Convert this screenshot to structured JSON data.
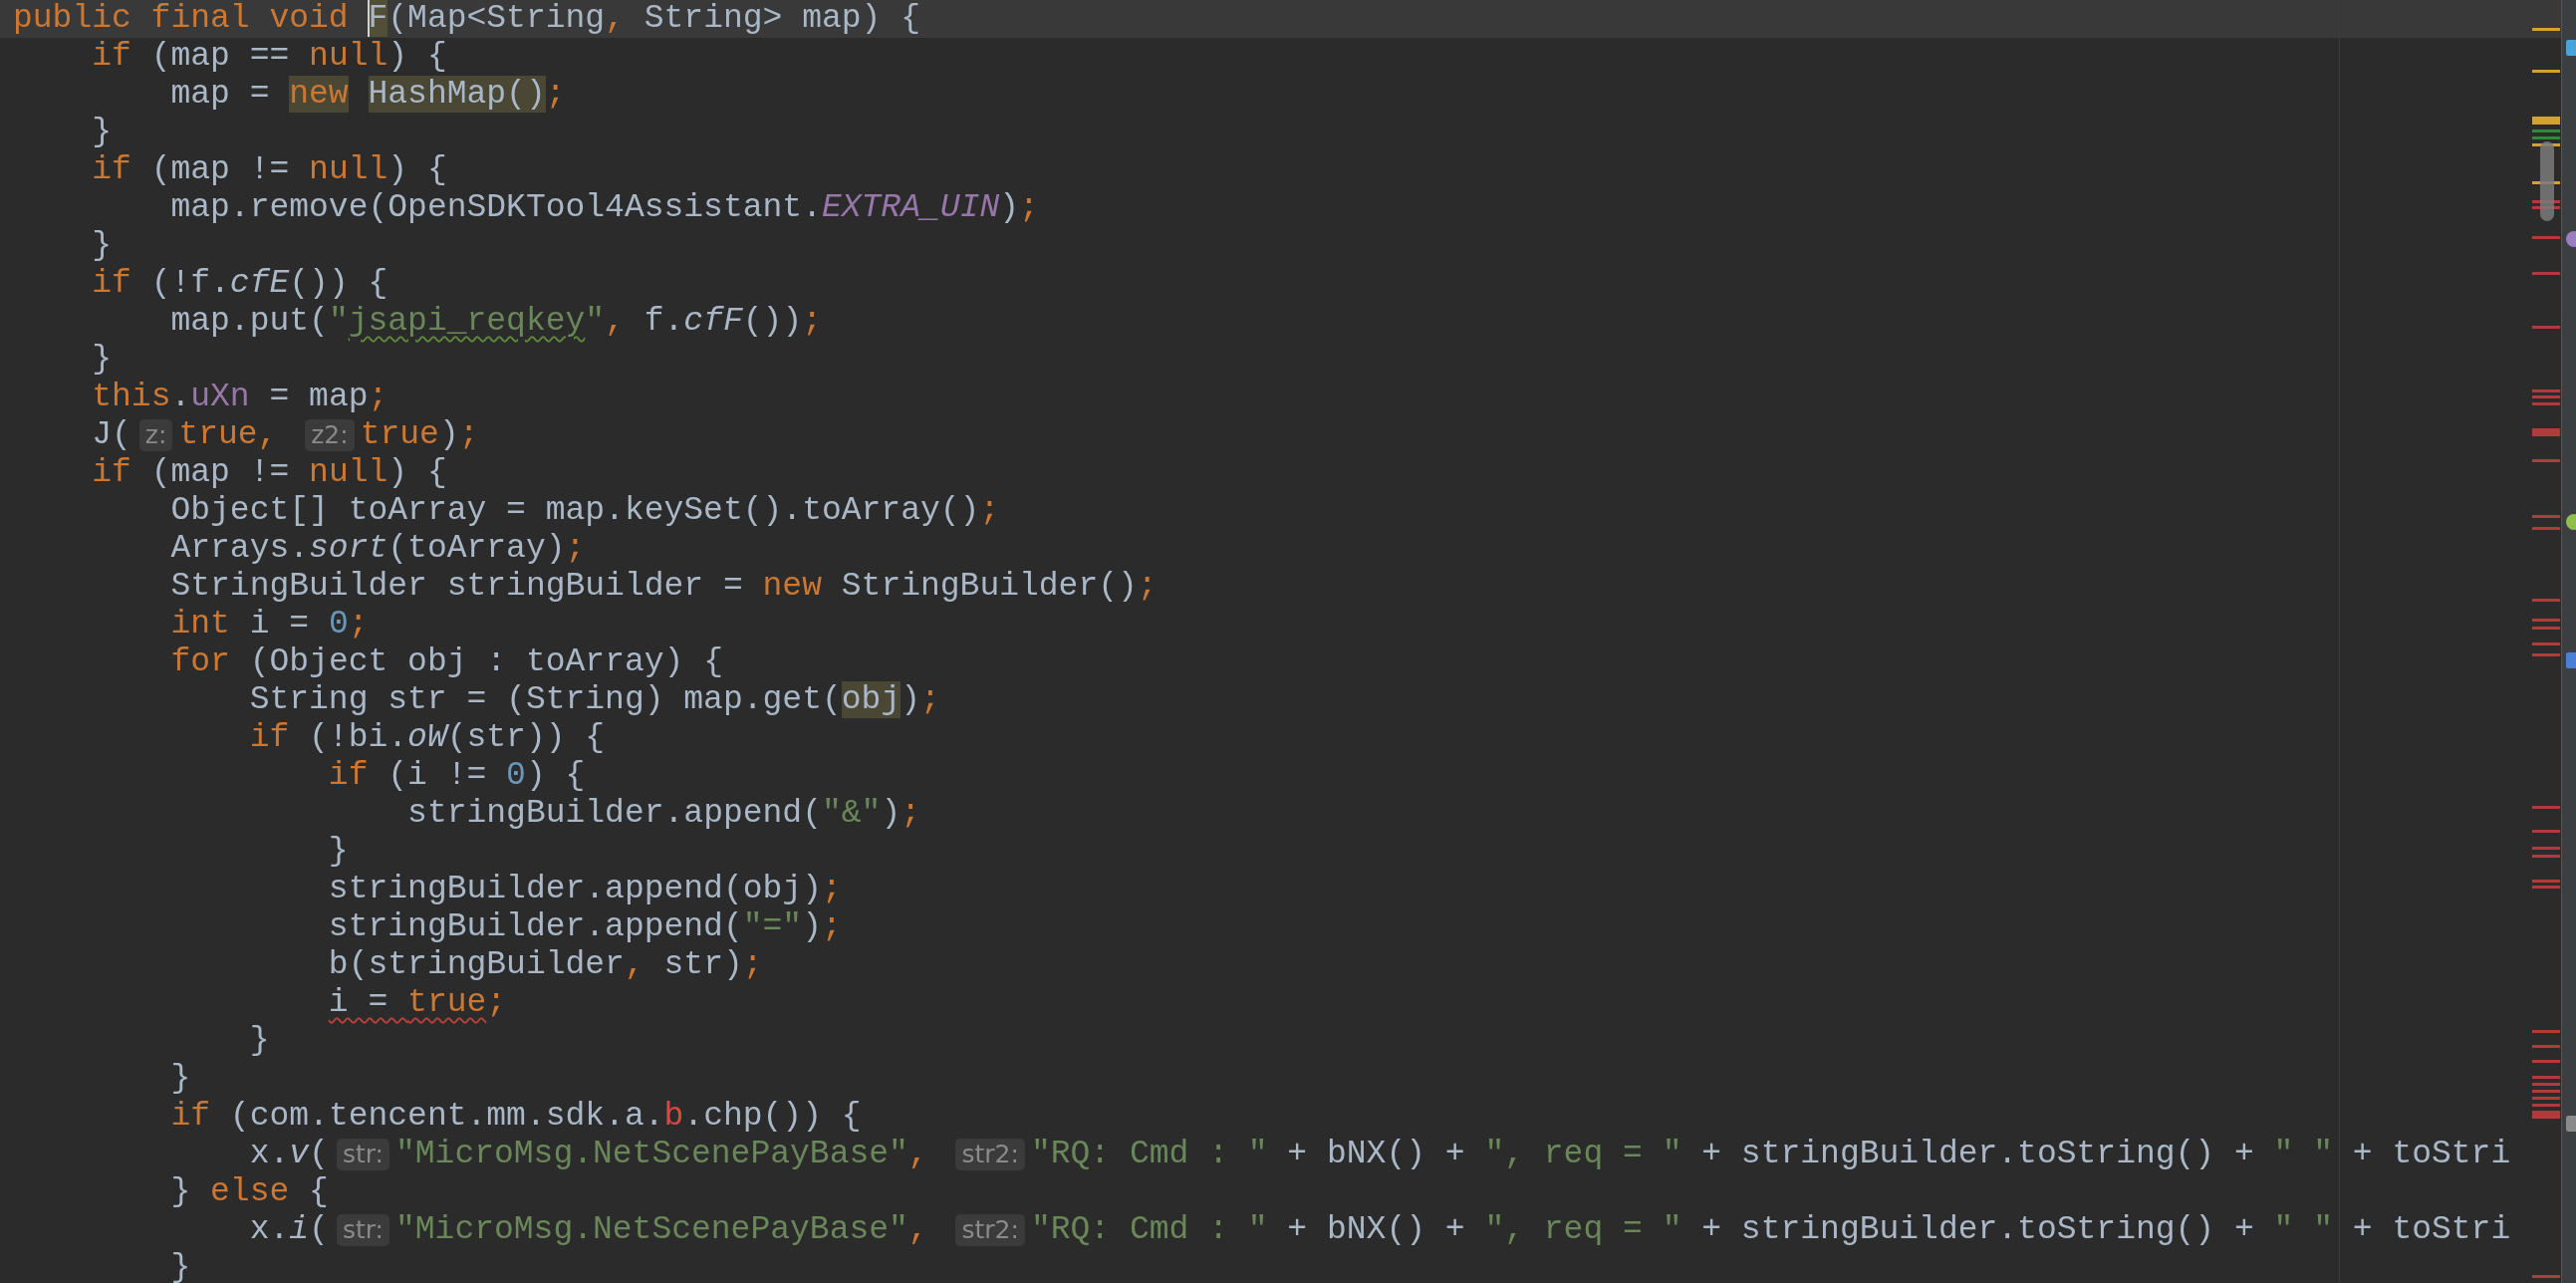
{
  "editor": {
    "lines": [
      {
        "current": true,
        "tokens": [
          {
            "text": "public final void ",
            "kind": "keyword"
          },
          {
            "text": "F",
            "kind": "plain",
            "caret": true
          },
          {
            "text": "(Map<String",
            "kind": "plain"
          },
          {
            "text": ", ",
            "kind": "keyword"
          },
          {
            "text": "String> map) {",
            "kind": "plain"
          }
        ]
      },
      {
        "current": false,
        "tokens": [
          {
            "text": "    if",
            "kind": "keyword"
          },
          {
            "text": " (map == ",
            "kind": "plain"
          },
          {
            "text": "null",
            "kind": "keyword"
          },
          {
            "text": ") {",
            "kind": "plain"
          }
        ]
      },
      {
        "current": false,
        "tokens": [
          {
            "text": "        map = ",
            "kind": "plain"
          },
          {
            "text": "new",
            "kind": "keyword",
            "usage_highlight": true
          },
          {
            "text": " HashMap()",
            "kind": "plain",
            "usage_highlight": true
          },
          {
            "text": ";",
            "kind": "keyword"
          }
        ]
      },
      {
        "current": false,
        "tokens": [
          {
            "text": "    }",
            "kind": "plain"
          }
        ]
      },
      {
        "current": false,
        "tokens": [
          {
            "text": "    if",
            "kind": "keyword"
          },
          {
            "text": " (map != ",
            "kind": "plain"
          },
          {
            "text": "null",
            "kind": "keyword"
          },
          {
            "text": ") {",
            "kind": "plain"
          }
        ]
      },
      {
        "current": false,
        "tokens": [
          {
            "text": "        map.remove(OpenSDKTool4Assistant.",
            "kind": "plain"
          },
          {
            "text": "EXTRA_UIN",
            "kind": "constant"
          },
          {
            "text": ")",
            "kind": "plain"
          },
          {
            "text": ";",
            "kind": "keyword"
          }
        ]
      },
      {
        "current": false,
        "tokens": [
          {
            "text": "    }",
            "kind": "plain"
          }
        ]
      },
      {
        "current": false,
        "tokens": [
          {
            "text": "    if",
            "kind": "keyword"
          },
          {
            "text": " (!f.",
            "kind": "plain"
          },
          {
            "text": "cfE",
            "kind": "method"
          },
          {
            "text": "()) {",
            "kind": "plain"
          }
        ]
      },
      {
        "current": false,
        "tokens": [
          {
            "text": "        map.put(",
            "kind": "plain"
          },
          {
            "text": "\"",
            "kind": "string"
          },
          {
            "text": "jsapi_reqkey",
            "kind": "string",
            "typo_underline": true
          },
          {
            "text": "\"",
            "kind": "string"
          },
          {
            "text": ", ",
            "kind": "keyword"
          },
          {
            "text": "f.",
            "kind": "plain"
          },
          {
            "text": "cfF",
            "kind": "method"
          },
          {
            "text": "())",
            "kind": "plain"
          },
          {
            "text": ";",
            "kind": "keyword"
          }
        ]
      },
      {
        "current": false,
        "tokens": [
          {
            "text": "    }",
            "kind": "plain"
          }
        ]
      },
      {
        "current": false,
        "tokens": [
          {
            "text": "    this",
            "kind": "keyword"
          },
          {
            "text": ".",
            "kind": "plain"
          },
          {
            "text": "uXn",
            "kind": "field"
          },
          {
            "text": " = map",
            "kind": "plain"
          },
          {
            "text": ";",
            "kind": "keyword"
          }
        ]
      },
      {
        "current": false,
        "tokens": [
          {
            "text": "    J(",
            "kind": "plain"
          },
          {
            "text": "z:",
            "kind": "hint"
          },
          {
            "text": "true",
            "kind": "keyword"
          },
          {
            "text": ", ",
            "kind": "keyword"
          },
          {
            "text": "z2:",
            "kind": "hint"
          },
          {
            "text": "true",
            "kind": "keyword"
          },
          {
            "text": ")",
            "kind": "plain"
          },
          {
            "text": ";",
            "kind": "keyword"
          }
        ]
      },
      {
        "current": false,
        "tokens": [
          {
            "text": "    if",
            "kind": "keyword"
          },
          {
            "text": " (map != ",
            "kind": "plain"
          },
          {
            "text": "null",
            "kind": "keyword"
          },
          {
            "text": ") {",
            "kind": "plain"
          }
        ]
      },
      {
        "current": false,
        "tokens": [
          {
            "text": "        Object[] toArray = map.keySet().toArray()",
            "kind": "plain"
          },
          {
            "text": ";",
            "kind": "keyword"
          }
        ]
      },
      {
        "current": false,
        "tokens": [
          {
            "text": "        Arrays.",
            "kind": "plain"
          },
          {
            "text": "sort",
            "kind": "method"
          },
          {
            "text": "(toArray)",
            "kind": "plain"
          },
          {
            "text": ";",
            "kind": "keyword"
          }
        ]
      },
      {
        "current": false,
        "tokens": [
          {
            "text": "        StringBuilder stringBuilder = ",
            "kind": "plain"
          },
          {
            "text": "new",
            "kind": "keyword"
          },
          {
            "text": " StringBuilder()",
            "kind": "plain"
          },
          {
            "text": ";",
            "kind": "keyword"
          }
        ]
      },
      {
        "current": false,
        "tokens": [
          {
            "text": "        int",
            "kind": "keyword"
          },
          {
            "text": " i = ",
            "kind": "plain"
          },
          {
            "text": "0",
            "kind": "number"
          },
          {
            "text": ";",
            "kind": "keyword"
          }
        ]
      },
      {
        "current": false,
        "tokens": [
          {
            "text": "        for",
            "kind": "keyword"
          },
          {
            "text": " (Object obj : toArray) {",
            "kind": "plain"
          }
        ]
      },
      {
        "current": false,
        "tokens": [
          {
            "text": "            String str = (String) map.get(",
            "kind": "plain"
          },
          {
            "text": "obj",
            "kind": "plain",
            "usage_highlight": true
          },
          {
            "text": ")",
            "kind": "plain"
          },
          {
            "text": ";",
            "kind": "keyword"
          }
        ]
      },
      {
        "current": false,
        "tokens": [
          {
            "text": "            if",
            "kind": "keyword"
          },
          {
            "text": " (!bi.",
            "kind": "plain"
          },
          {
            "text": "oW",
            "kind": "method"
          },
          {
            "text": "(str)) {",
            "kind": "plain"
          }
        ]
      },
      {
        "current": false,
        "tokens": [
          {
            "text": "                if",
            "kind": "keyword"
          },
          {
            "text": " (i != ",
            "kind": "plain"
          },
          {
            "text": "0",
            "kind": "number"
          },
          {
            "text": ") {",
            "kind": "plain"
          }
        ]
      },
      {
        "current": false,
        "tokens": [
          {
            "text": "                    stringBuilder.append(",
            "kind": "plain"
          },
          {
            "text": "\"&\"",
            "kind": "string"
          },
          {
            "text": ")",
            "kind": "plain"
          },
          {
            "text": ";",
            "kind": "keyword"
          }
        ]
      },
      {
        "current": false,
        "tokens": [
          {
            "text": "                }",
            "kind": "plain"
          }
        ]
      },
      {
        "current": false,
        "tokens": [
          {
            "text": "                stringBuilder.append(obj)",
            "kind": "plain"
          },
          {
            "text": ";",
            "kind": "keyword"
          }
        ]
      },
      {
        "current": false,
        "tokens": [
          {
            "text": "                stringBuilder.append(",
            "kind": "plain"
          },
          {
            "text": "\"=\"",
            "kind": "string"
          },
          {
            "text": ")",
            "kind": "plain"
          },
          {
            "text": ";",
            "kind": "keyword"
          }
        ]
      },
      {
        "current": false,
        "tokens": [
          {
            "text": "                b(stringBuilder",
            "kind": "plain"
          },
          {
            "text": ", ",
            "kind": "keyword"
          },
          {
            "text": "str)",
            "kind": "plain"
          },
          {
            "text": ";",
            "kind": "keyword"
          }
        ]
      },
      {
        "current": false,
        "tokens": [
          {
            "text": "                i = ",
            "kind": "plain",
            "error_underline": true
          },
          {
            "text": "true",
            "kind": "keyword",
            "error_underline": true
          },
          {
            "text": ";",
            "kind": "keyword"
          }
        ]
      },
      {
        "current": false,
        "tokens": [
          {
            "text": "            }",
            "kind": "plain"
          }
        ]
      },
      {
        "current": false,
        "tokens": [
          {
            "text": "        }",
            "kind": "plain"
          }
        ]
      },
      {
        "current": false,
        "tokens": [
          {
            "text": "        if",
            "kind": "keyword"
          },
          {
            "text": " (com.tencent.mm.sdk.a.",
            "kind": "plain"
          },
          {
            "text": "b",
            "kind": "unresolved"
          },
          {
            "text": ".chp()) {",
            "kind": "plain"
          }
        ]
      },
      {
        "current": false,
        "tokens": [
          {
            "text": "            x.",
            "kind": "plain"
          },
          {
            "text": "v",
            "kind": "method"
          },
          {
            "text": "(",
            "kind": "plain"
          },
          {
            "text": "str:",
            "kind": "hint"
          },
          {
            "text": "\"MicroMsg.NetScenePayBase\"",
            "kind": "string"
          },
          {
            "text": ", ",
            "kind": "keyword"
          },
          {
            "text": "str2:",
            "kind": "hint"
          },
          {
            "text": "\"RQ: Cmd : \"",
            "kind": "string"
          },
          {
            "text": " + bNX() + ",
            "kind": "plain"
          },
          {
            "text": "\", req = \"",
            "kind": "string"
          },
          {
            "text": " + stringBuilder.toString() + ",
            "kind": "plain"
          },
          {
            "text": "\" \"",
            "kind": "string"
          },
          {
            "text": " + toStri",
            "kind": "plain"
          }
        ]
      },
      {
        "current": false,
        "tokens": [
          {
            "text": "        } ",
            "kind": "plain"
          },
          {
            "text": "else",
            "kind": "keyword"
          },
          {
            "text": " {",
            "kind": "plain"
          }
        ]
      },
      {
        "current": false,
        "tokens": [
          {
            "text": "            x.",
            "kind": "plain"
          },
          {
            "text": "i",
            "kind": "method"
          },
          {
            "text": "(",
            "kind": "plain"
          },
          {
            "text": "str:",
            "kind": "hint"
          },
          {
            "text": "\"MicroMsg.NetScenePayBase\"",
            "kind": "string"
          },
          {
            "text": ", ",
            "kind": "keyword"
          },
          {
            "text": "str2:",
            "kind": "hint"
          },
          {
            "text": "\"RQ: Cmd : \"",
            "kind": "string"
          },
          {
            "text": " + bNX() + ",
            "kind": "plain"
          },
          {
            "text": "\", req = \"",
            "kind": "string"
          },
          {
            "text": " + stringBuilder.toString() + ",
            "kind": "plain"
          },
          {
            "text": "\" \"",
            "kind": "string"
          },
          {
            "text": " + toStri",
            "kind": "plain"
          }
        ]
      },
      {
        "current": false,
        "tokens": [
          {
            "text": "        }",
            "kind": "plain"
          }
        ]
      }
    ]
  }
}
